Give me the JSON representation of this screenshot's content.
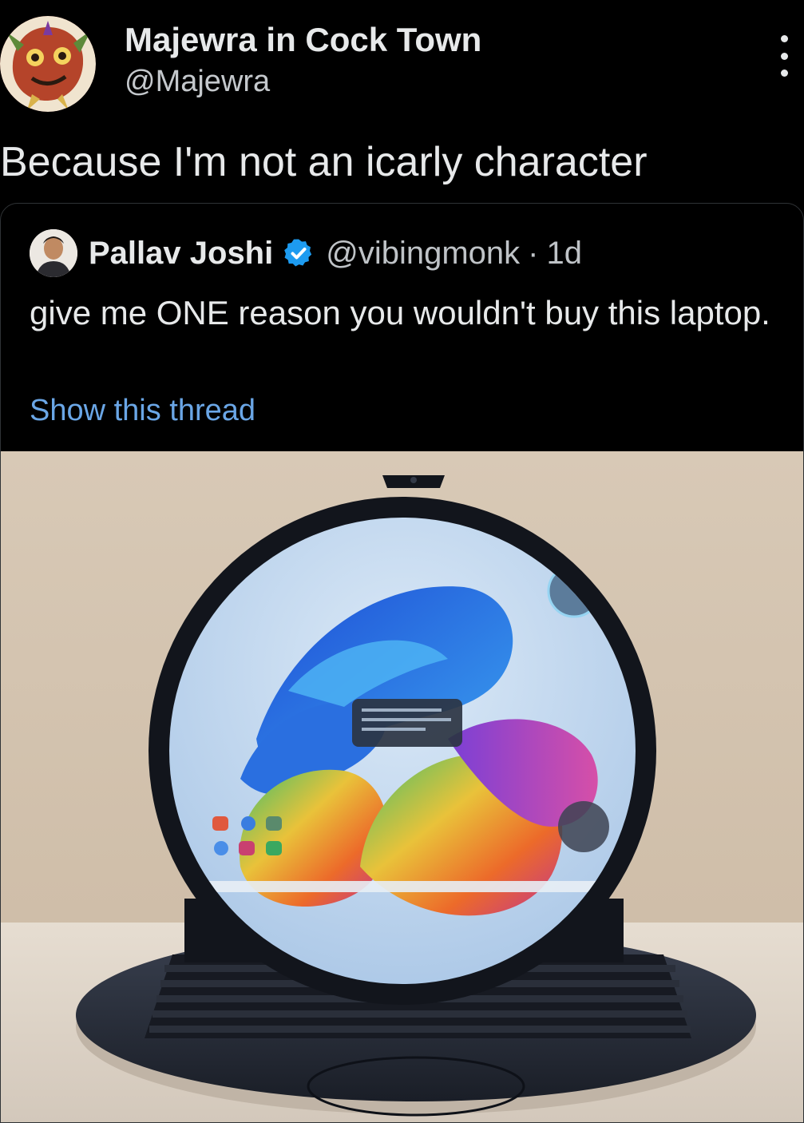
{
  "tweet": {
    "author_name": "Majewra in Cock Town",
    "author_handle": "@Majewra",
    "text": "Because I'm not an icarly character"
  },
  "quoted_tweet": {
    "author_name": "Pallav Joshi",
    "author_handle": "@vibingmonk",
    "separator": "·",
    "time": "1d",
    "text": "give me ONE reason you wouldn't buy this laptop.",
    "show_thread_label": "Show this thread"
  },
  "icons": {
    "more": "more-options-icon",
    "verified": "verified-badge-icon"
  },
  "colors": {
    "background": "#000000",
    "text": "#e7e9ea",
    "secondary_text": "#bfc3c7",
    "link": "#6aa6e6",
    "verified": "#1d9bf0"
  }
}
